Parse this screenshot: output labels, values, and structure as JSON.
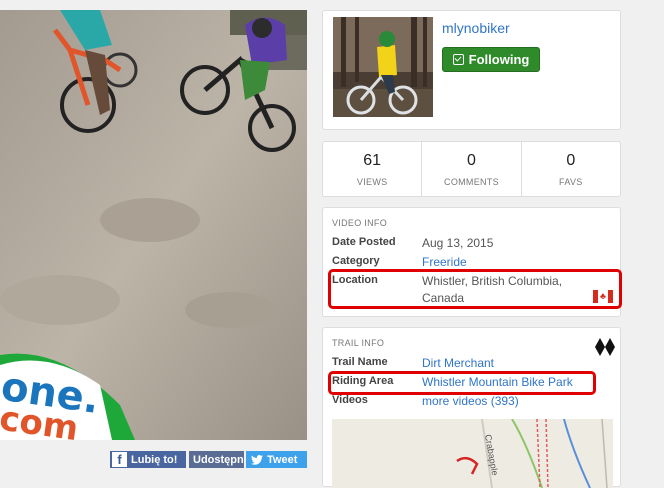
{
  "share": {
    "facebook_label": "Lubię to!",
    "facebook_icon": "facebook-icon",
    "share_label": "Udostępnij",
    "tweet_label": "Tweet",
    "tweet_icon": "twitter-bird-icon"
  },
  "profile": {
    "username": "mlynobiker",
    "follow_label": "Following",
    "follow_icon": "check-square-icon",
    "follow_color": "#2f8a29"
  },
  "stats": [
    {
      "value": "61",
      "label": "VIEWS"
    },
    {
      "value": "0",
      "label": "COMMENTS"
    },
    {
      "value": "0",
      "label": "FAVS"
    }
  ],
  "video_info": {
    "title": "VIDEO INFO",
    "date_label": "Date Posted",
    "date_value": "Aug 13, 2015",
    "category_label": "Category",
    "category_value": "Freeride",
    "location_label": "Location",
    "location_value": "Whistler, British Columbia, Canada",
    "location_flag_icon": "canada-flag-icon"
  },
  "trail_info": {
    "title": "TRAIL INFO",
    "difficulty_icon": "double-black-diamond-icon",
    "trail_label": "Trail Name",
    "trail_value": "Dirt Merchant",
    "area_label": "Riding Area",
    "area_value": "Whistler Mountain Bike Park",
    "videos_label": "Videos",
    "videos_value": "more videos (393)",
    "map_label": "Crabapple"
  },
  "highlight_color": "#e00000",
  "link_color": "#3175c8"
}
